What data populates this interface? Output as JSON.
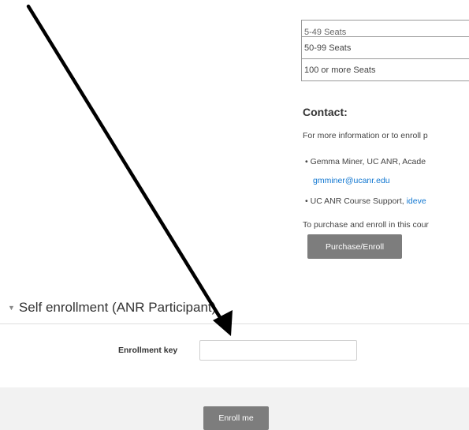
{
  "seats_table": {
    "rows": [
      "5-49 Seats",
      "50-99 Seats",
      "100 or more Seats"
    ]
  },
  "contact": {
    "heading": "Contact:",
    "intro": "For more information or to enroll p",
    "bullet_1": "Gemma Miner, UC ANR, Acade",
    "bullet_1_email": "gmminer@ucanr.edu",
    "bullet_2_text": "UC ANR Course Support,",
    "bullet_2_link": "ideve",
    "purchase_text": "To purchase and enroll in this cour",
    "purchase_button": "Purchase/Enroll"
  },
  "self_enrollment": {
    "title": "Self enrollment (ANR Participant)",
    "enrollment_key_label": "Enrollment key",
    "enrollment_key_value": "",
    "enroll_button": "Enroll me"
  },
  "annotation": {
    "icon": "arrow-annotation",
    "color": "#000000"
  }
}
